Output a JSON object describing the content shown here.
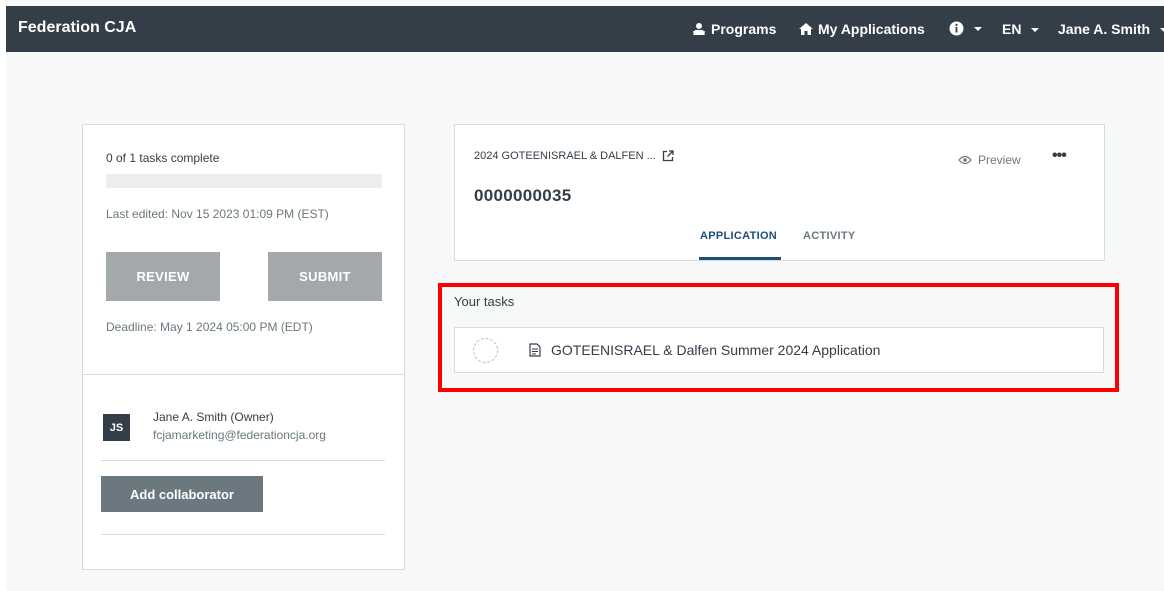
{
  "app": {
    "brand": "Federation CJA"
  },
  "nav": {
    "programs": "Programs",
    "my_applications": "My Applications",
    "language": "EN",
    "user": "Jane A. Smith"
  },
  "status_panel": {
    "tasks_complete": "0 of 1 tasks complete",
    "progress_fraction": 0,
    "last_edited": "Last edited: Nov 15 2023 01:09 PM (EST)",
    "review_label": "REVIEW",
    "submit_label": "SUBMIT",
    "deadline": "Deadline: May 1 2024 05:00 PM (EDT)"
  },
  "collaborators": {
    "owner_initials": "JS",
    "owner_name": "Jane A. Smith (Owner)",
    "owner_email": "fcjamarketing@federationcja.org",
    "add_label": "Add collaborator"
  },
  "application": {
    "program_name": "2024 GOTEENISRAEL & DALFEN ...",
    "number": "0000000035",
    "preview_label": "Preview",
    "more_label": "•••",
    "tabs": [
      {
        "label": "APPLICATION",
        "active": true
      },
      {
        "label": "ACTIVITY",
        "active": false
      }
    ]
  },
  "tasks": {
    "heading": "Your tasks",
    "items": [
      {
        "title": "GOTEENISRAEL & Dalfen Summer 2024 Application",
        "status": "incomplete"
      }
    ]
  },
  "colors": {
    "nav_bg": "#333e48",
    "button_disabled": "#a3a8ab",
    "button_secondary": "#6b787f",
    "tab_active": "#1e4d78",
    "highlight": "#ff0000"
  }
}
